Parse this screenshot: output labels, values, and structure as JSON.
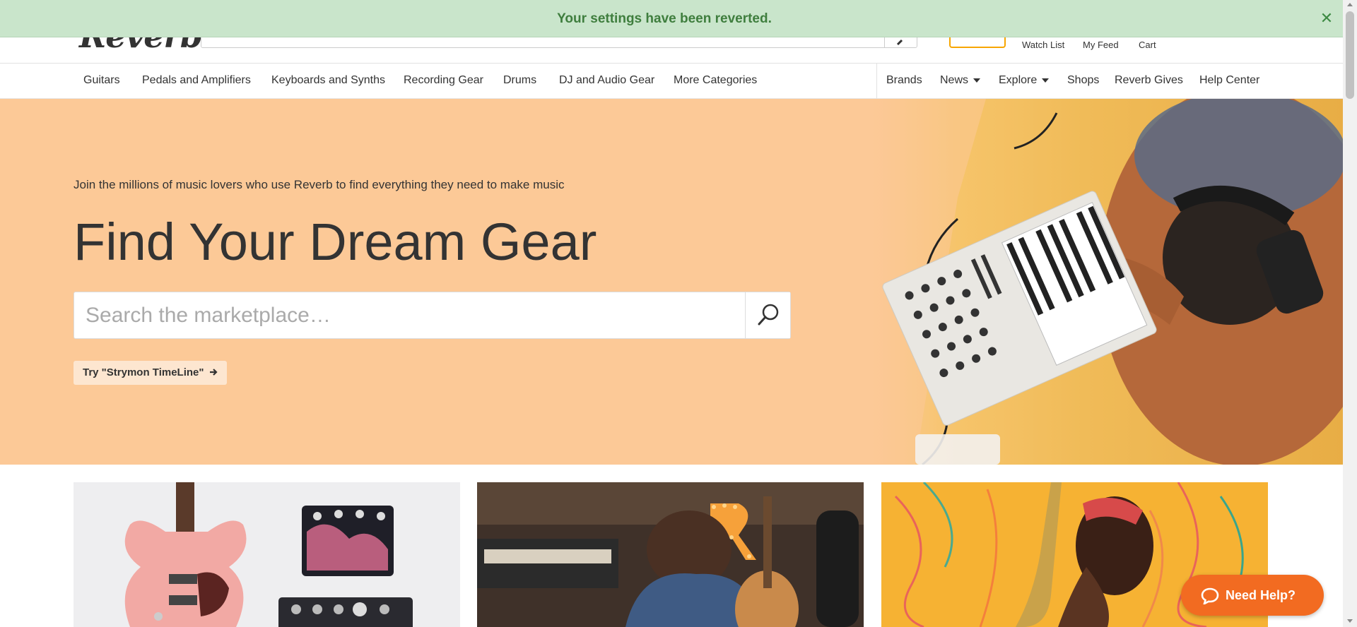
{
  "banner": {
    "message": "Your settings have been reverted.",
    "close_glyph": "✕",
    "color": "#c9e5cb"
  },
  "header": {
    "logo_text": "Reverb",
    "links": {
      "watch_list": "Watch List",
      "my_feed": "My Feed",
      "cart": "Cart"
    }
  },
  "catnav": {
    "categories": [
      "Guitars",
      "Pedals and Amplifiers",
      "Keyboards and Synths",
      "Recording Gear",
      "Drums",
      "DJ and Audio Gear",
      "More Categories"
    ],
    "right_links": [
      "Brands",
      "News",
      "Explore",
      "Shops",
      "Reverb Gives",
      "Help Center"
    ]
  },
  "hero": {
    "tagline": "Join the millions of music lovers who use Reverb to find everything they need to make music",
    "title": "Find Your Dream Gear",
    "search_placeholder": "Search the marketplace…",
    "try_label": "Try \"Strymon TimeLine\"",
    "bg_color": "#fcc997"
  },
  "help": {
    "label": "Need Help?",
    "color": "#f26b21"
  },
  "icons": [
    "search-icon",
    "close-icon",
    "chevron-down-icon",
    "arrow-right-icon",
    "chat-bubble-icon"
  ]
}
